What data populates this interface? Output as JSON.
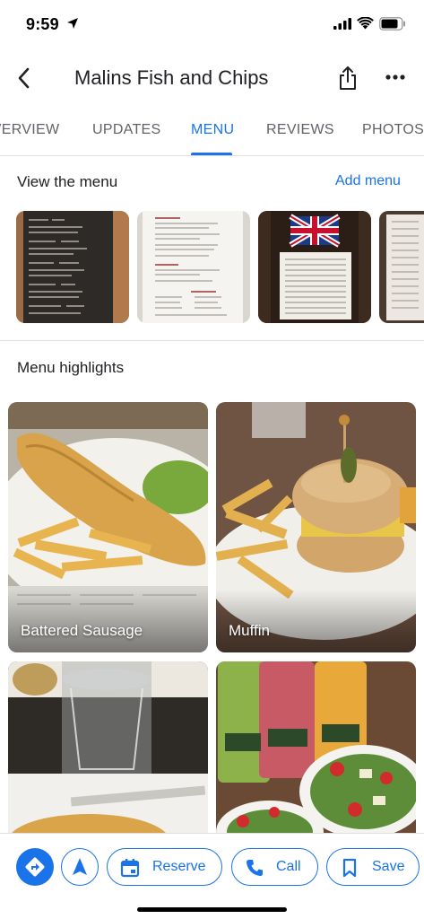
{
  "status_bar": {
    "time": "9:59"
  },
  "header": {
    "title": "Malins Fish and Chips"
  },
  "tabs": [
    {
      "label": "OVERVIEW"
    },
    {
      "label": "UPDATES"
    },
    {
      "label": "MENU"
    },
    {
      "label": "REVIEWS"
    },
    {
      "label": "PHOTOS"
    }
  ],
  "menu_section": {
    "title": "View the menu",
    "add_label": "Add menu"
  },
  "highlights": {
    "title": "Menu highlights",
    "items": [
      {
        "label": "Battered Sausage"
      },
      {
        "label": "Muffin"
      },
      {
        "label": ""
      },
      {
        "label": ""
      }
    ]
  },
  "actions": {
    "reserve": "Reserve",
    "call": "Call",
    "save": "Save"
  },
  "colors": {
    "accent": "#1a73e8",
    "text": "#202124",
    "muted": "#5f6368"
  },
  "icons": [
    "location-arrow-icon",
    "cellular-icon",
    "wifi-icon",
    "battery-icon",
    "back-arrow-icon",
    "share-icon",
    "more-icon",
    "directions-icon",
    "navigate-icon",
    "calendar-icon",
    "phone-icon",
    "bookmark-icon"
  ]
}
